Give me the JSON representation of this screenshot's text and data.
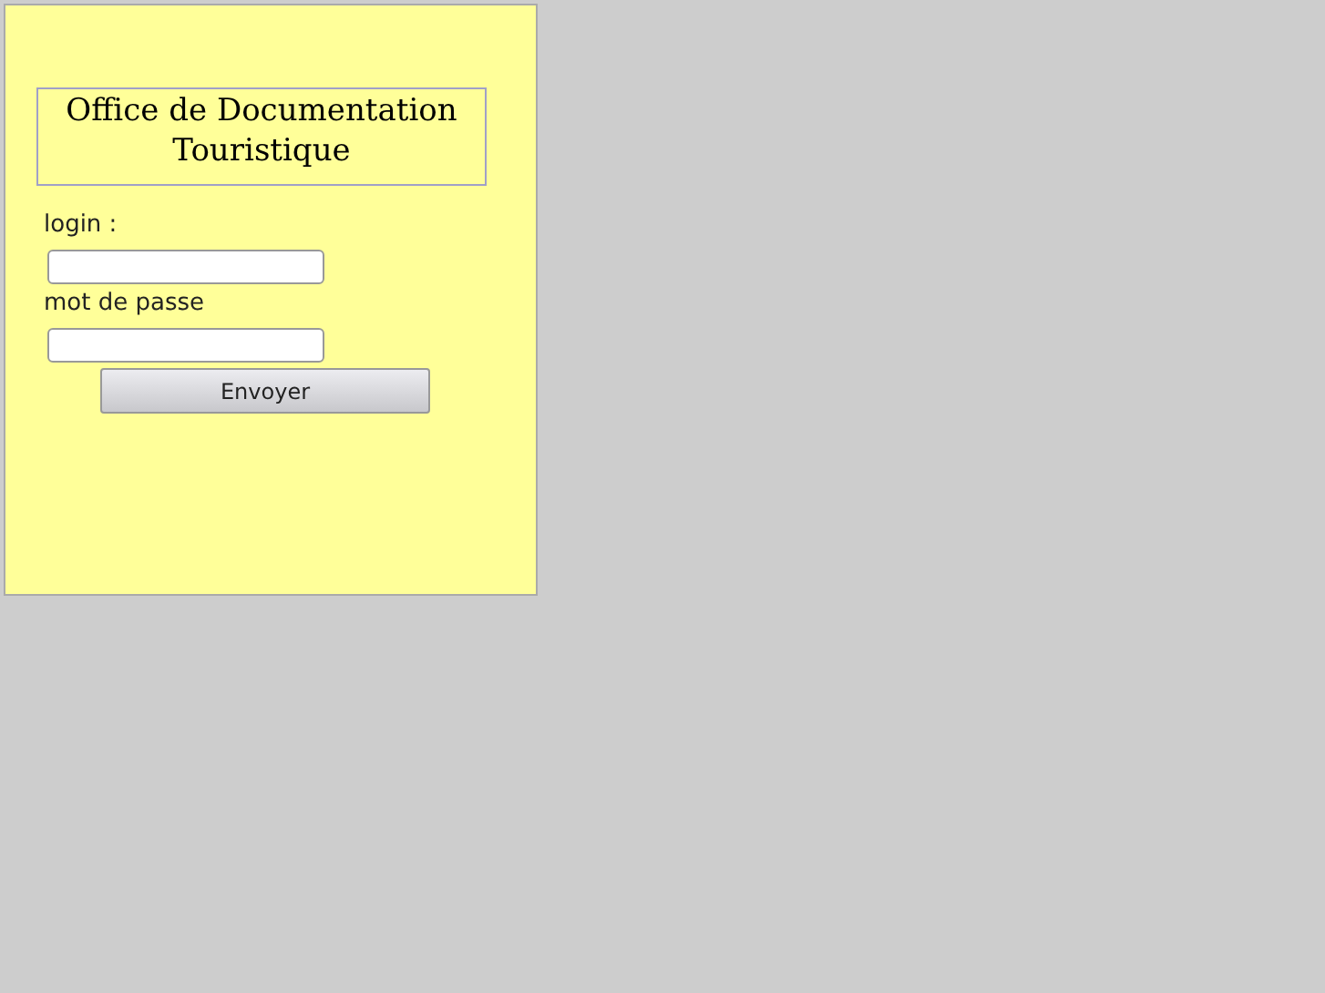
{
  "title": "Office de Documentation Touristique",
  "fields": [
    {
      "label": "login :"
    },
    {
      "label": "mot de passe"
    }
  ],
  "submit": {
    "label": "Envoyer"
  }
}
